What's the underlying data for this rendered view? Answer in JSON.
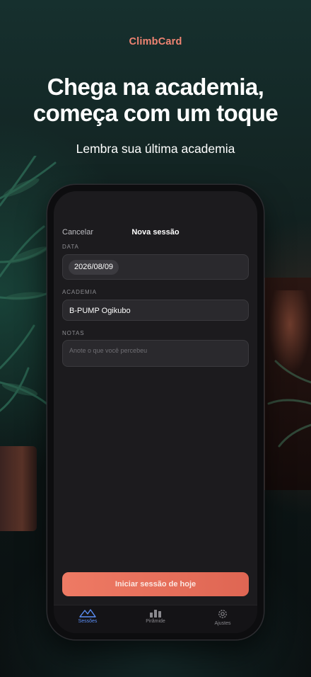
{
  "brand": "ClimbCard",
  "headline": {
    "line1": "Chega na academia,",
    "line2": "começa com um toque"
  },
  "subheadline": "Lembra sua última academia",
  "screen": {
    "nav": {
      "cancel": "Cancelar",
      "title": "Nova sessão"
    },
    "date": {
      "label": "DATA",
      "value": "2026/08/09"
    },
    "gym": {
      "label": "ACADEMIA",
      "value": "B-PUMP Ogikubo"
    },
    "notes": {
      "label": "NOTAS",
      "placeholder": "Anote o que você percebeu"
    },
    "primary_button": "Iniciar sessão de hoje",
    "tabs": [
      {
        "label": "Sessões",
        "icon": "mountain-icon",
        "active": true
      },
      {
        "label": "Pirâmide",
        "icon": "bar-chart-icon",
        "active": false
      },
      {
        "label": "Ajustes",
        "icon": "gear-icon",
        "active": false
      }
    ]
  },
  "colors": {
    "accent": "#ee7a64",
    "active_tab": "#5b8ef5",
    "brand": "#ef8472"
  }
}
